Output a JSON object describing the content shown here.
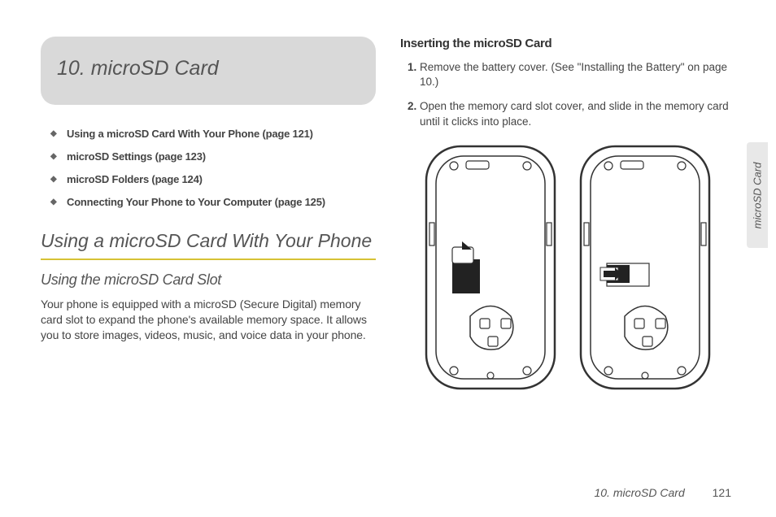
{
  "chapter": {
    "title": "10. microSD Card"
  },
  "toc": {
    "items": [
      "Using a microSD Card With Your Phone (page 121)",
      "microSD Settings (page 123)",
      "microSD Folders (page 124)",
      "Connecting Your Phone to Your Computer (page 125)"
    ]
  },
  "section": {
    "h2": "Using a microSD Card With Your Phone",
    "h3": "Using the microSD Card Slot",
    "body": "Your phone is equipped with a microSD (Secure Digital) memory card slot to expand the phone's available memory space. It allows you to store images, videos, music, and voice data in your phone."
  },
  "right": {
    "subhead": "Inserting the microSD Card",
    "steps": [
      "Remove the battery cover. (See \"Installing the Battery\" on page 10.)",
      "Open the memory card slot cover, and slide in the memory card until it clicks into place."
    ]
  },
  "sidetab": "microSD Card",
  "footer": {
    "chapter": "10. microSD Card",
    "page": "121"
  }
}
